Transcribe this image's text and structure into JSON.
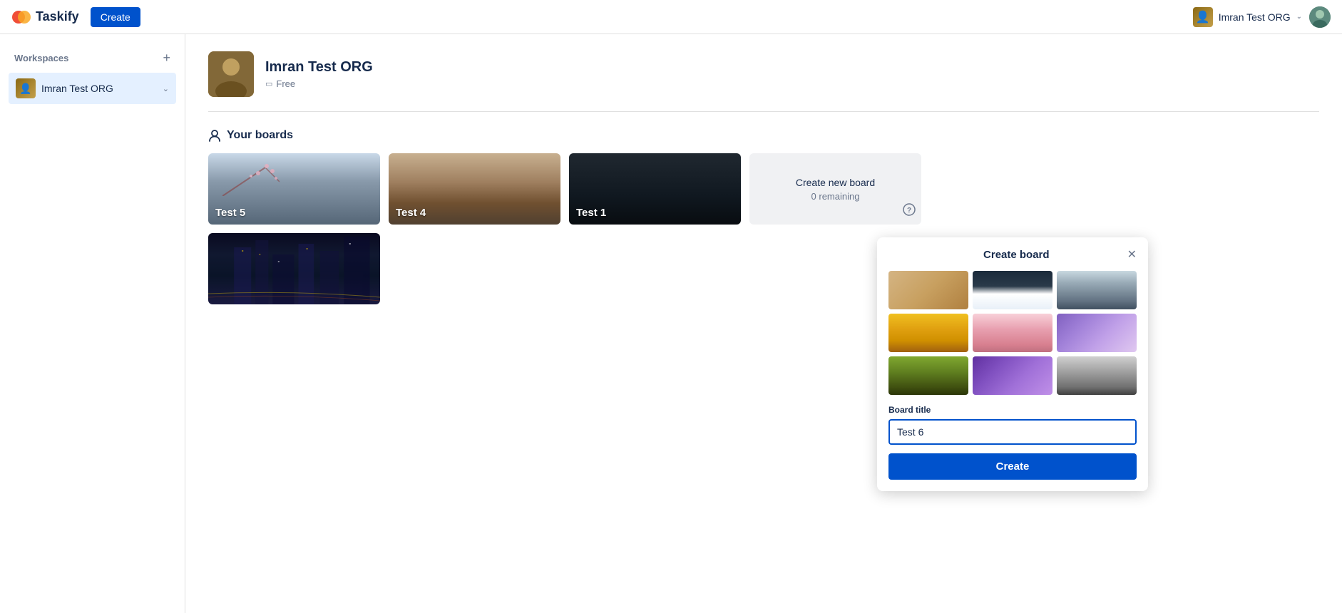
{
  "header": {
    "logo_text": "Taskify",
    "create_label": "Create",
    "org_name": "Imran Test ORG",
    "chevron": "⌄"
  },
  "sidebar": {
    "section_title": "Workspaces",
    "add_button": "+",
    "workspace": {
      "name": "Imran Test ORG",
      "chevron": "⌄"
    }
  },
  "org_header": {
    "name": "Imran Test ORG",
    "plan_label": "Free",
    "plan_icon": "▭"
  },
  "boards_section": {
    "heading": "Your boards",
    "boards": [
      {
        "id": "test5",
        "title": "Test 5",
        "bg_class": "bg-test5"
      },
      {
        "id": "test4",
        "title": "Test 4",
        "bg_class": "bg-test4"
      },
      {
        "id": "test1",
        "title": "Test 1",
        "bg_class": "bg-test1"
      },
      {
        "id": "create",
        "title": ""
      },
      {
        "id": "city",
        "title": "",
        "bg_class": "bg-city"
      }
    ],
    "create_new_board_label": "Create new board",
    "remaining_label": "0 remaining",
    "help_icon": "?"
  },
  "create_board_popup": {
    "title": "Create board",
    "close_icon": "✕",
    "thumbnails": [
      {
        "id": "desert",
        "class": "thumb-desert"
      },
      {
        "id": "mountains",
        "class": "thumb-mountains"
      },
      {
        "id": "cliff",
        "class": "thumb-cliff"
      },
      {
        "id": "sunflower",
        "class": "thumb-sunflower"
      },
      {
        "id": "cherry",
        "class": "thumb-cherry"
      },
      {
        "id": "planet",
        "class": "thumb-planet"
      },
      {
        "id": "meadow",
        "class": "thumb-meadow"
      },
      {
        "id": "aurora",
        "class": "thumb-aurora"
      },
      {
        "id": "rocky",
        "class": "thumb-rocky"
      }
    ],
    "board_title_label": "Board title",
    "board_title_placeholder": "",
    "board_title_value": "Test 6",
    "create_button_label": "Create"
  }
}
